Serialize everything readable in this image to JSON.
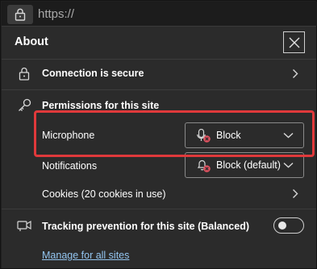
{
  "address_bar": {
    "url": "https://"
  },
  "panel": {
    "title": "About",
    "connection": "Connection is secure",
    "permissions_header": "Permissions for this site",
    "microphone": {
      "label": "Microphone",
      "value": "Block"
    },
    "notifications": {
      "label": "Notifications",
      "value": "Block (default)"
    },
    "cookies": "Cookies (20 cookies in use)",
    "tracking": {
      "label": "Tracking prevention for this site (Balanced)",
      "enabled": false
    },
    "manage_link": "Manage for all sites"
  },
  "colors": {
    "highlight": "#e0393b",
    "link": "#93c5f0",
    "block_badge": "#e05260"
  }
}
